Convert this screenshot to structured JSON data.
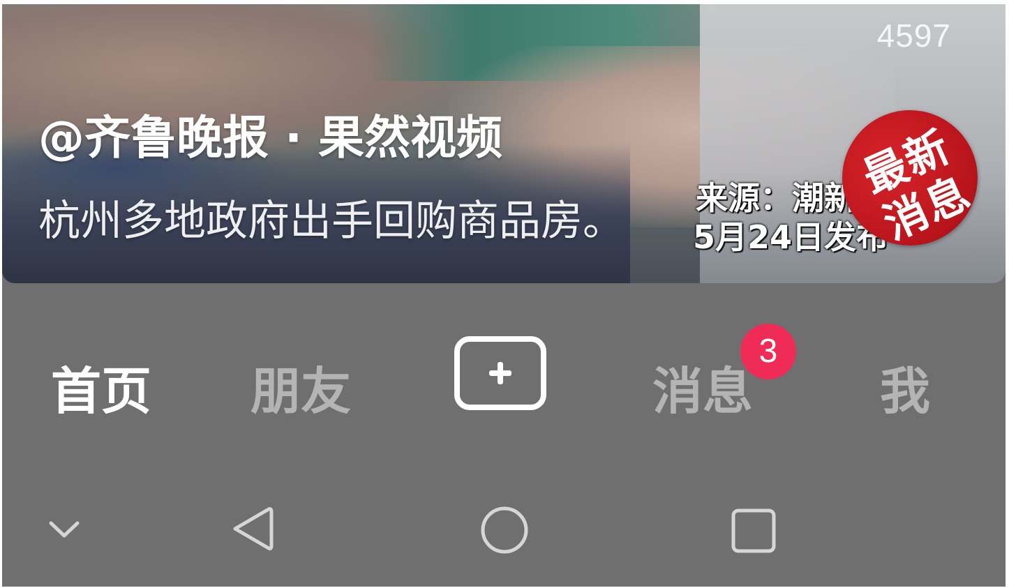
{
  "video": {
    "view_count": "4597",
    "author": "@齐鲁晚报 · 果然视频",
    "description": "杭州多地政府出手回购商品房。",
    "overlay_caption": {
      "line1": "来源：潮新闻",
      "line2": "5月24日发布"
    },
    "badge": {
      "line1": "最新",
      "line2": "消息",
      "color": "#c8161d"
    }
  },
  "tabbar": {
    "tabs": [
      {
        "label": "首页",
        "active": true
      },
      {
        "label": "朋友",
        "active": false
      },
      {
        "label": "消息",
        "active": false,
        "badge": "3"
      },
      {
        "label": "我",
        "active": false
      }
    ],
    "create_icon": "plus-square-icon",
    "badge_color": "#f02b55"
  },
  "system_nav": {
    "icons": [
      "chevron-down-icon",
      "back-triangle-icon",
      "home-circle-icon",
      "recents-square-icon"
    ]
  }
}
